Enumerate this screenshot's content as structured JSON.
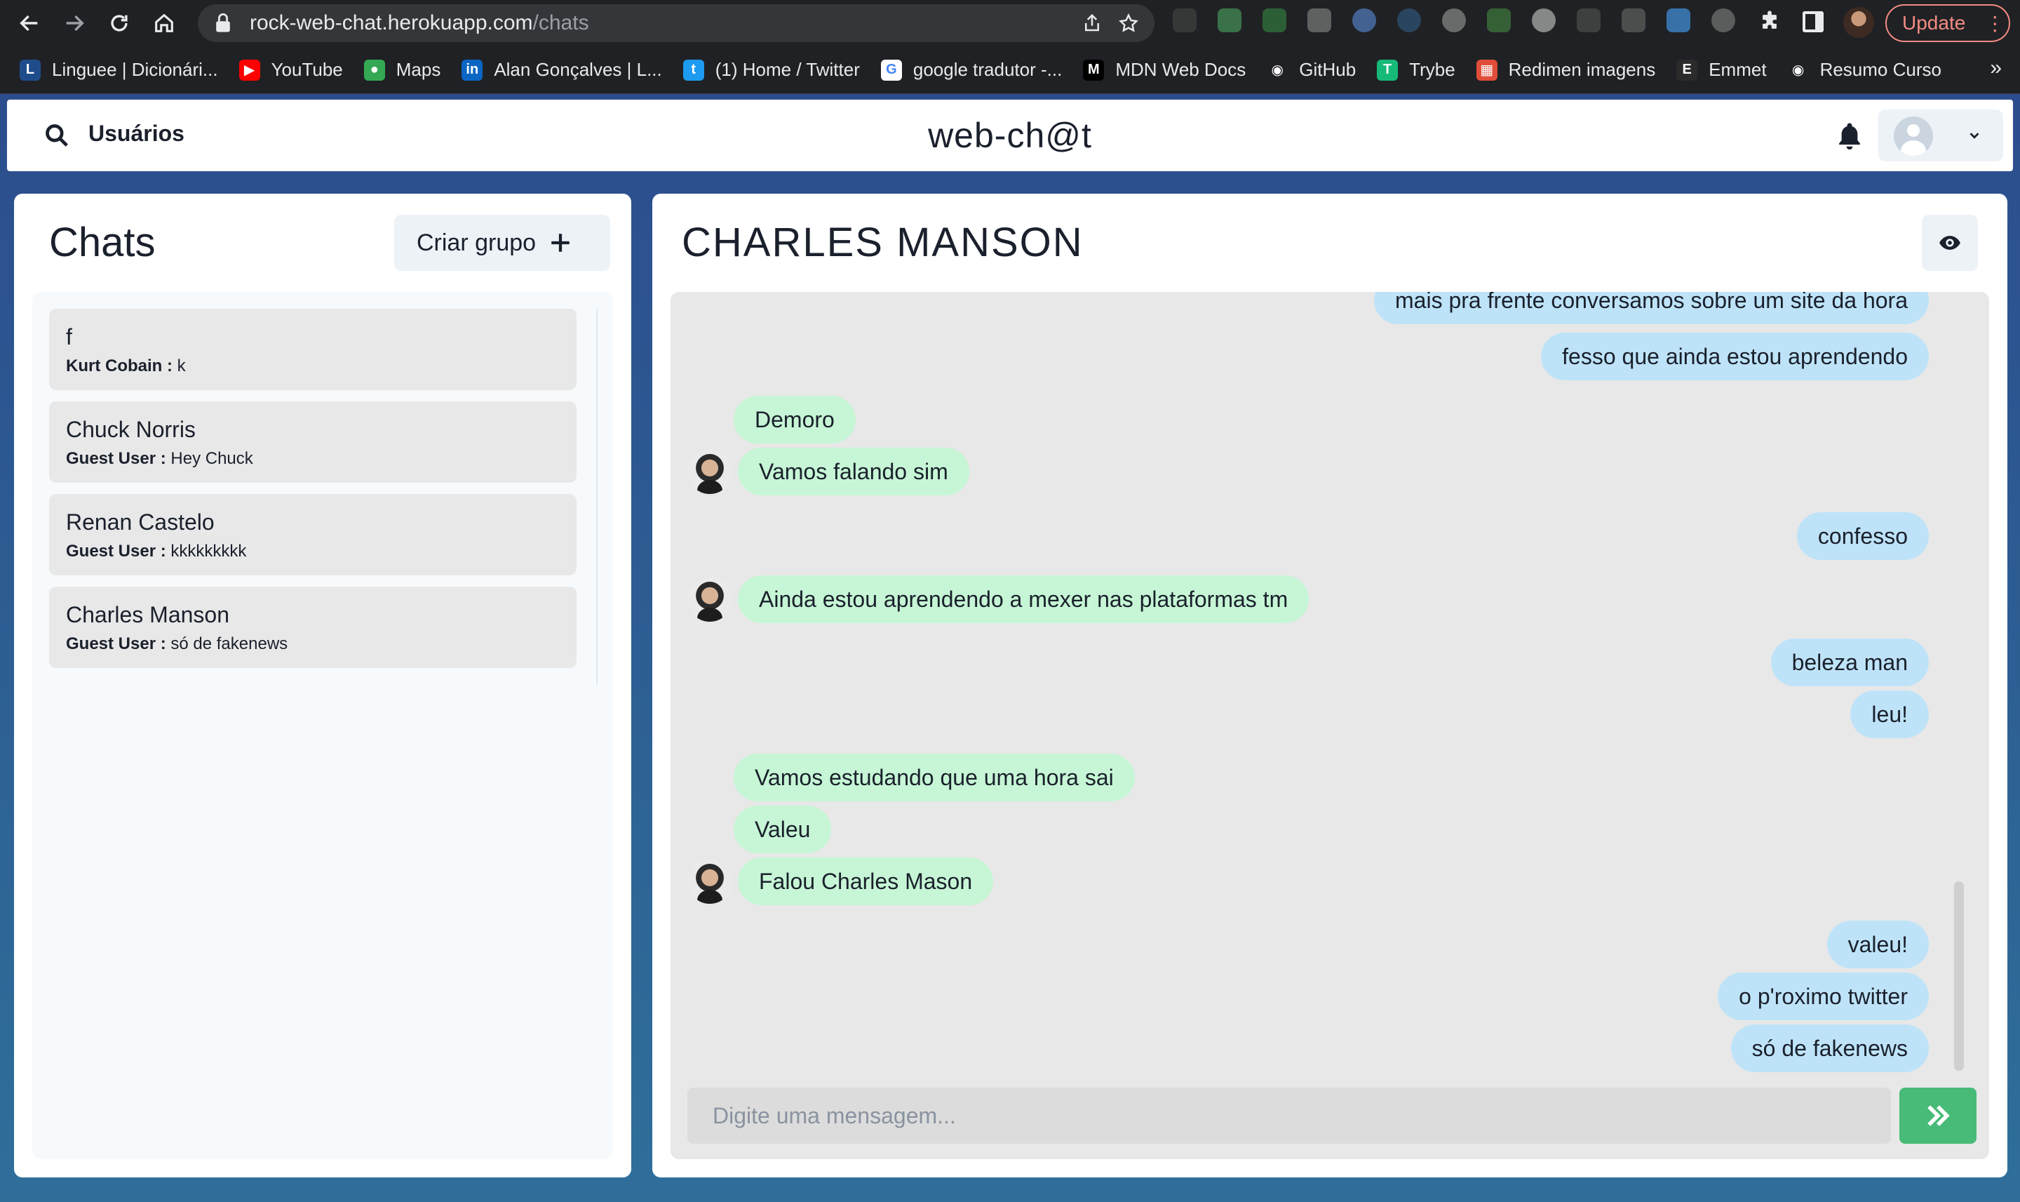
{
  "browser": {
    "url_host": "rock-web-chat.herokuapp.com",
    "url_path": "/chats",
    "update_label": "Update",
    "bookmarks": [
      {
        "label": "Linguee | Dicionári...",
        "color": "#1f4d8c",
        "glyph": "L"
      },
      {
        "label": "YouTube",
        "color": "#ff0000",
        "glyph": "▶"
      },
      {
        "label": "Maps",
        "color": "#34a853",
        "glyph": "●"
      },
      {
        "label": "Alan Gonçalves | L...",
        "color": "#0a66c2",
        "glyph": "in"
      },
      {
        "label": "(1) Home / Twitter",
        "color": "#1d9bf0",
        "glyph": "t"
      },
      {
        "label": "google tradutor -...",
        "color": "#ffffff",
        "glyph": "G"
      },
      {
        "label": "MDN Web Docs",
        "color": "#000000",
        "glyph": "M"
      },
      {
        "label": "GitHub",
        "color": "#202124",
        "glyph": "◉"
      },
      {
        "label": "Trybe",
        "color": "#17b978",
        "glyph": "T"
      },
      {
        "label": "Redimen imagens",
        "color": "#e04e3a",
        "glyph": "▦"
      },
      {
        "label": "Emmet",
        "color": "#2b2b2b",
        "glyph": "E"
      },
      {
        "label": "Resumo Curso",
        "color": "#202124",
        "glyph": "◉"
      }
    ],
    "more_label": "»"
  },
  "header": {
    "users_label": "Usuários",
    "app_title": "web-ch@t"
  },
  "chats": {
    "title": "Chats",
    "create_group_label": "Criar grupo",
    "items": [
      {
        "name": "f",
        "sender": "Kurt Cobain :",
        "text": " k"
      },
      {
        "name": "Chuck Norris",
        "sender": "Guest User :",
        "text": " Hey Chuck"
      },
      {
        "name": "Renan Castelo",
        "sender": "Guest User :",
        "text": " kkkkkkkkk"
      },
      {
        "name": "Charles Manson",
        "sender": "Guest User :",
        "text": " só de fakenews"
      }
    ]
  },
  "conversation": {
    "title": "CHARLES MANSON",
    "messages": [
      {
        "text": "mais pra frente conversamos sobre um site da hora",
        "dir": "out"
      },
      {
        "text": "fesso que ainda estou aprendendo",
        "dir": "out"
      },
      {
        "text": "Demoro",
        "dir": "in"
      },
      {
        "text": "Vamos falando sim",
        "dir": "in"
      },
      {
        "text": "confesso",
        "dir": "out"
      },
      {
        "text": "Ainda estou aprendendo a mexer nas plataformas tm",
        "dir": "in"
      },
      {
        "text": "beleza man",
        "dir": "out"
      },
      {
        "text": "leu!",
        "dir": "out"
      },
      {
        "text": "Vamos estudando que uma hora sai",
        "dir": "in"
      },
      {
        "text": "Valeu",
        "dir": "in"
      },
      {
        "text": "Falou Charles Mason",
        "dir": "in"
      },
      {
        "text": "valeu!",
        "dir": "out"
      },
      {
        "text": "o p'roximo twitter",
        "dir": "out"
      },
      {
        "text": "só de fakenews",
        "dir": "out"
      }
    ],
    "composer_placeholder": "Digite uma mensagem..."
  },
  "colors": {
    "outgoing_bubble": "#bee3f8",
    "incoming_bubble": "#c6f6d5",
    "send_button": "#48bb78",
    "background_gradient_top": "#2b4a8c",
    "background_gradient_bottom": "#2f6f9a"
  },
  "icons": [
    "back-icon",
    "forward-icon",
    "reload-icon",
    "home-icon",
    "lock-icon",
    "share-icon",
    "star-icon",
    "puzzle-icon",
    "search-icon",
    "bell-icon",
    "chevron-down-icon",
    "plus-icon",
    "eye-icon",
    "double-chevron-right-icon"
  ]
}
